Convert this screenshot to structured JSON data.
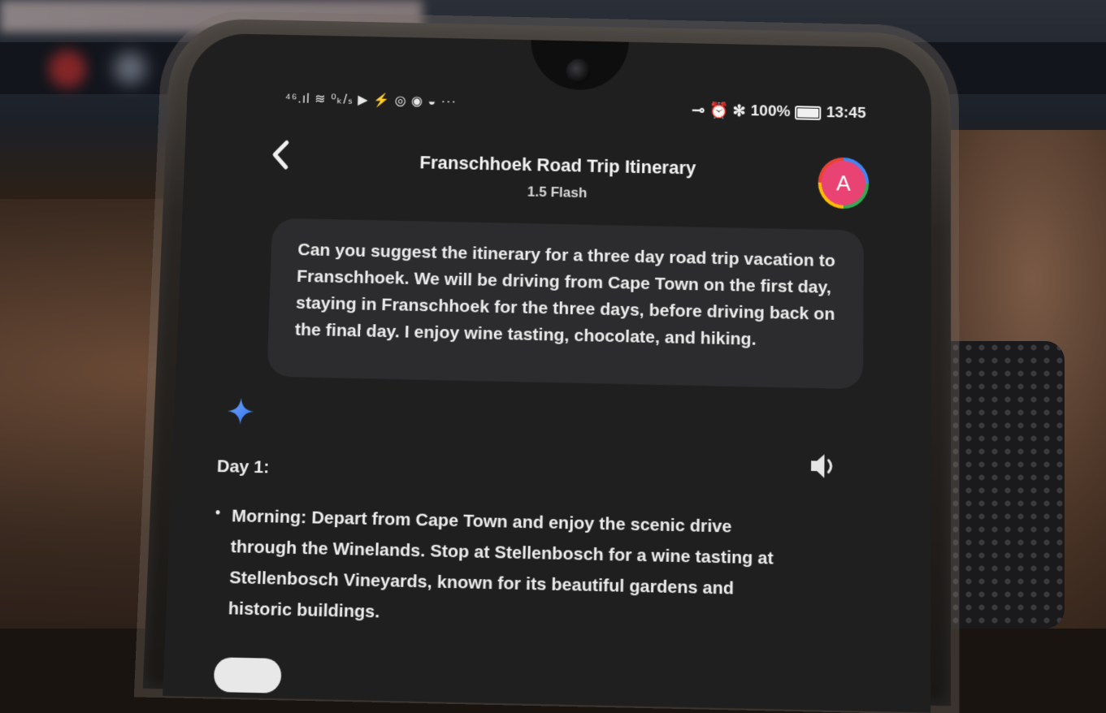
{
  "status_bar": {
    "left_icons": "⁴⁶.ıl ≋ ⁰ₖ/ₛ ▶ ⚡ ◎ ◉ ◒ ···",
    "right_icons": "⊸ ⏰ ✻",
    "battery": "100%",
    "time": "13:45"
  },
  "header": {
    "back_icon": "chevron-left-icon",
    "title": "Franschhoek Road Trip Itinerary",
    "subtitle": "1.5 Flash",
    "avatar_letter": "A"
  },
  "prompt": {
    "text": "Can you suggest the itinerary for a three day road trip vacation to Franschhoek. We will be driving from Cape Town on the first day, staying in Franschhoek for the three days, before driving back on the final day. I enjoy wine tasting, chocolate, and hiking."
  },
  "response": {
    "icon": "gemini-spark-icon",
    "speaker_icon": "speaker-icon",
    "day_heading": "Day 1:",
    "bullet": "•",
    "morning": "Morning: Depart from Cape Town and enjoy the scenic drive through the Winelands. Stop at Stellenbosch for a wine tasting at Stellenbosch Vineyards, known for its beautiful gardens and historic buildings."
  },
  "colors": {
    "screen_bg": "#1f1f1f",
    "bubble_bg": "#2c2c2e",
    "avatar_bg": "#e94374",
    "spark": "#4a8cff"
  }
}
